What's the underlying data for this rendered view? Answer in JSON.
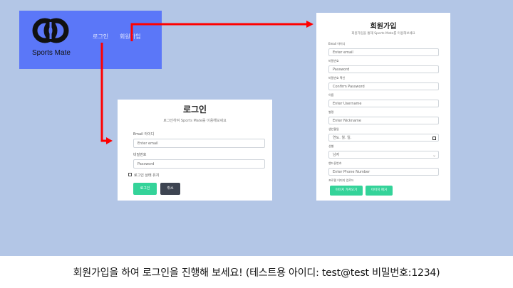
{
  "nav": {
    "brand": "Sports Mate",
    "login": "로그인",
    "signup": "회원가입"
  },
  "login": {
    "title": "로그인",
    "subtitle": "로그인하여 Sports Mate를 이용해보세요",
    "email_label": "Email 아이디",
    "email_placeholder": "Enter email",
    "password_label": "비밀번호",
    "password_placeholder": "Password",
    "remember_label": "로그인 상태 유지",
    "submit": "로그인",
    "cancel": "취소"
  },
  "signup": {
    "title": "회원가입",
    "subtitle": "회원가입을 통해 Sports Mate를 이용해보세요",
    "email_label": "Email 아이디",
    "email_placeholder": "Enter email",
    "password_label": "비밀번호",
    "password_placeholder": "Password",
    "confirm_label": "비밀번호 확인",
    "confirm_placeholder": "Confirm Password",
    "name_label": "이름",
    "name_placeholder": "Enter Username",
    "nickname_label": "별명",
    "nickname_placeholder": "Enter Nickname",
    "birth_label": "생년월일",
    "birth_placeholder": "연도. 월. 일.",
    "gender_label": "성별",
    "gender_value": "남자",
    "phone_label": "핸드폰번호",
    "phone_placeholder": "Enter Phone Number",
    "photo_label": "프로필 이미지 업로드",
    "add_photo": "이미지 가져오기",
    "remove_photo": "이미지 제거"
  },
  "caption": "회원가입을 하여 로그인을 진행해 보세요! (테스트용 아이디: test@test   비밀번호:1234)",
  "colors": {
    "background": "#b3c6e6",
    "navbar": "#5b77f8",
    "arrow": "#ff0000",
    "primary_button": "#34d399",
    "secondary_button": "#3d4451"
  }
}
